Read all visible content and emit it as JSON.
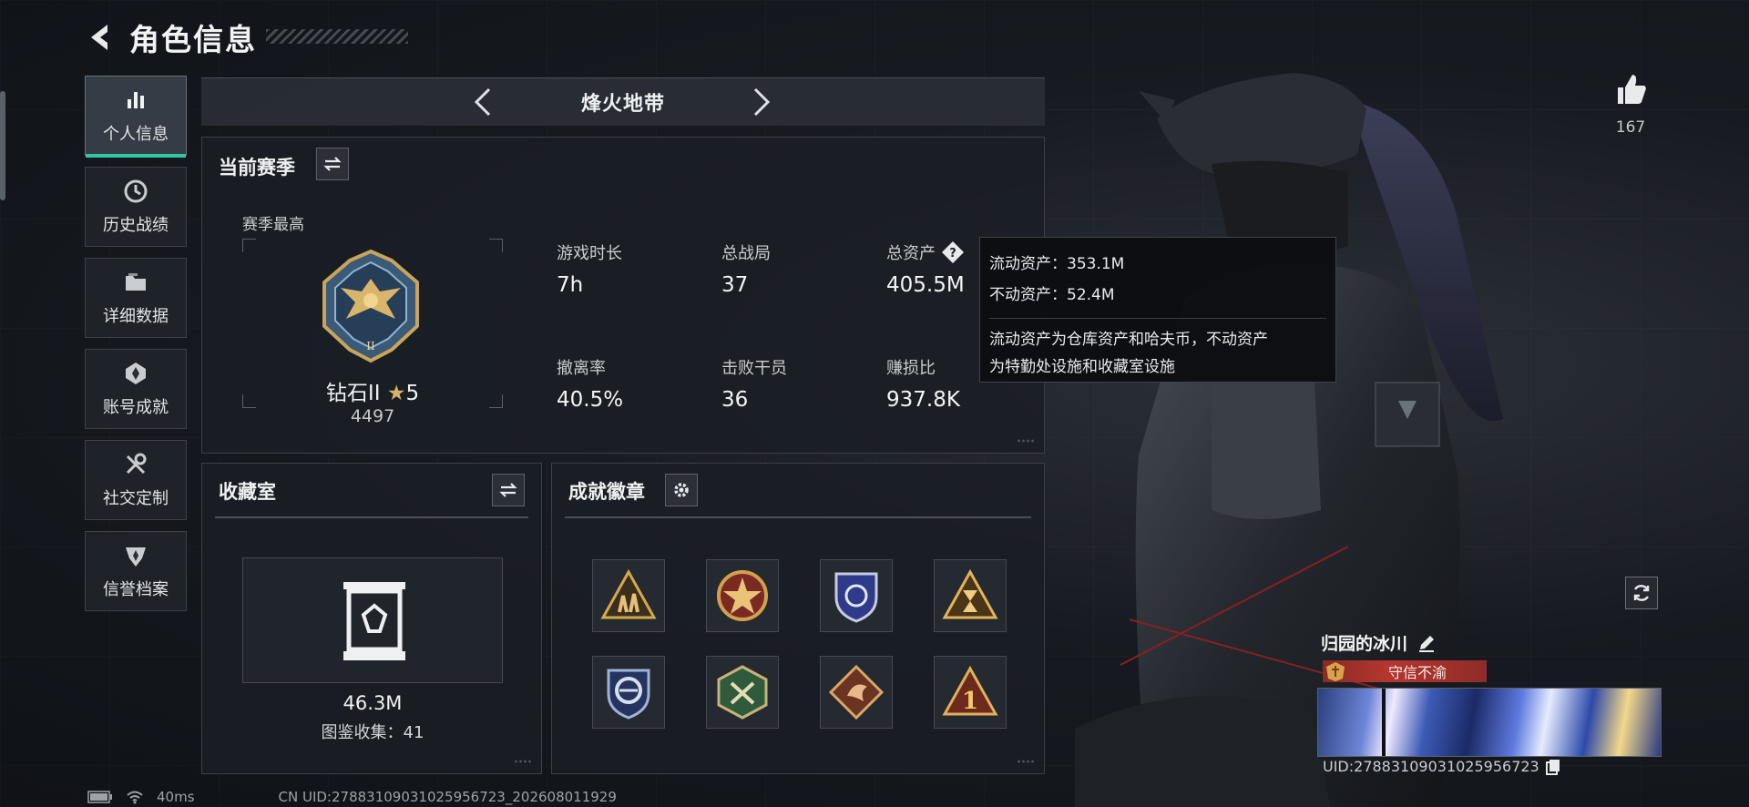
{
  "header": {
    "title": "角色信息"
  },
  "sidebar": {
    "items": [
      {
        "label": "个人信息",
        "icon": "bar-chart-icon",
        "active": true
      },
      {
        "label": "历史战绩",
        "icon": "history-clock-icon",
        "active": false
      },
      {
        "label": "详细数据",
        "icon": "folder-icon",
        "active": false
      },
      {
        "label": "账号成就",
        "icon": "achievement-icon",
        "active": false
      },
      {
        "label": "社交定制",
        "icon": "tools-icon",
        "active": false
      },
      {
        "label": "信誉档案",
        "icon": "reputation-shield-icon",
        "active": false
      }
    ]
  },
  "mode": {
    "title": "烽火地带"
  },
  "season": {
    "title": "当前赛季",
    "subtitle": "赛季最高",
    "rank_name": "钻石II",
    "rank_stars": "5",
    "rank_score": "4497",
    "stats": [
      {
        "label": "游戏时长",
        "value": "7h"
      },
      {
        "label": "总战局",
        "value": "37"
      },
      {
        "label": "总资产",
        "value": "405.5M"
      },
      {
        "label": "撤离率",
        "value": "40.5%"
      },
      {
        "label": "击败干员",
        "value": "36"
      },
      {
        "label": "赚损比",
        "value": "937.8K"
      }
    ]
  },
  "tooltip": {
    "liquid": "流动资产：353.1M",
    "fixed": "不动资产：52.4M",
    "desc1": "流动资产为仓库资产和哈夫币，不动资产",
    "desc2": "为特勤处设施和收藏室设施"
  },
  "collection": {
    "title": "收藏室",
    "value": "46.3M",
    "sub": "图鉴收集：41"
  },
  "badges": {
    "title": "成就徽章",
    "items": [
      {
        "icon": "soldiers-triangle-badge-icon"
      },
      {
        "icon": "red-star-badge-icon"
      },
      {
        "icon": "blue-shield-badge-icon"
      },
      {
        "icon": "hourglass-triangle-badge-icon"
      },
      {
        "icon": "blue-circle-badge-icon"
      },
      {
        "icon": "green-shield-badge-icon"
      },
      {
        "icon": "dragon-diamond-badge-icon"
      },
      {
        "icon": "number-one-triangle-badge-icon"
      }
    ]
  },
  "player": {
    "likes": "167",
    "name": "归园的冰川",
    "honor": "守信不渝",
    "uid_short": "UID:27883109031025956723"
  },
  "footer": {
    "ping": "40ms",
    "uid": "CN UID:27883109031025956723_202608011929"
  },
  "colors": {
    "accent": "#31c7a6",
    "honor_red": "#b5362f",
    "gold": "#d6b36a"
  }
}
